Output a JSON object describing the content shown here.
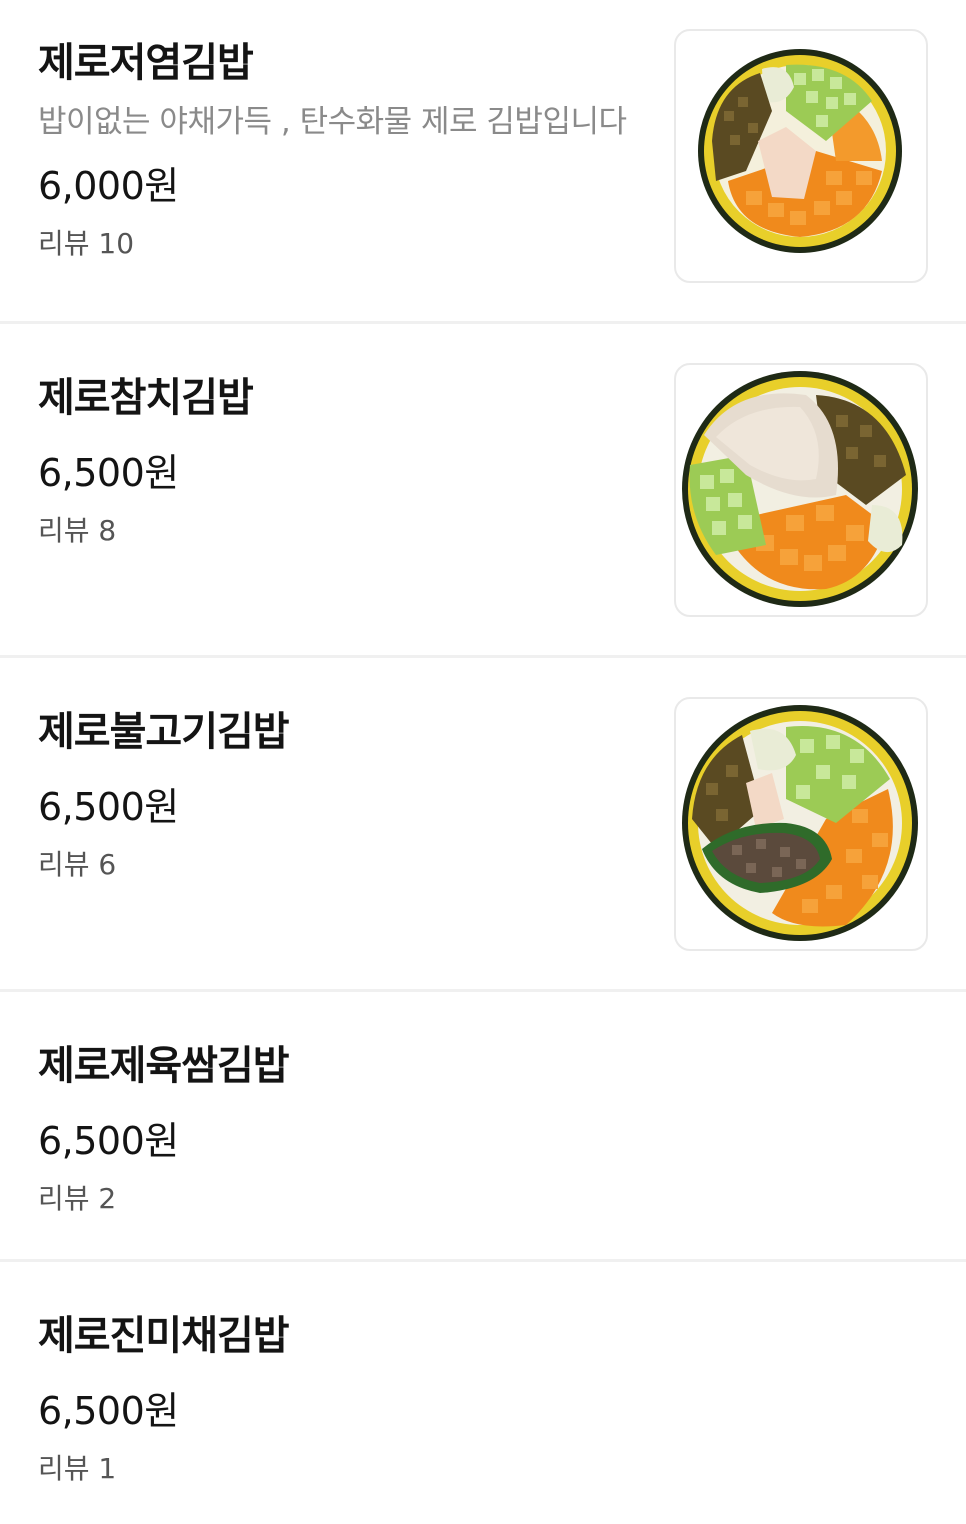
{
  "menu": {
    "items": [
      {
        "name": "제로저염김밥",
        "description": "밥이없는 야채가득 , 탄수화물 제로 김밥입니다",
        "price": "6,000원",
        "review": "리뷰 10",
        "image": "kimbap-thumbnail-low-salt"
      },
      {
        "name": "제로참치김밥",
        "price": "6,500원",
        "review": "리뷰 8",
        "image": "kimbap-thumbnail-tuna"
      },
      {
        "name": "제로불고기김밥",
        "price": "6,500원",
        "review": "리뷰 6",
        "image": "kimbap-thumbnail-bulgogi"
      },
      {
        "name": "제로제육쌈김밥",
        "price": "6,500원",
        "review": "리뷰 2"
      },
      {
        "name": "제로진미채김밥",
        "price": "6,500원",
        "review": "리뷰 1"
      }
    ]
  },
  "colors": {
    "divider": "#f0f0f0",
    "description": "#8a8a8a",
    "egg": "#e8cf2a",
    "carrot": "#f08a1c",
    "cucumber": "#9ccb55",
    "seaweed": "#1f2a16",
    "burdock": "#5a4a22",
    "beef": "#5b4a3c",
    "tuna": "#e6dccf"
  }
}
